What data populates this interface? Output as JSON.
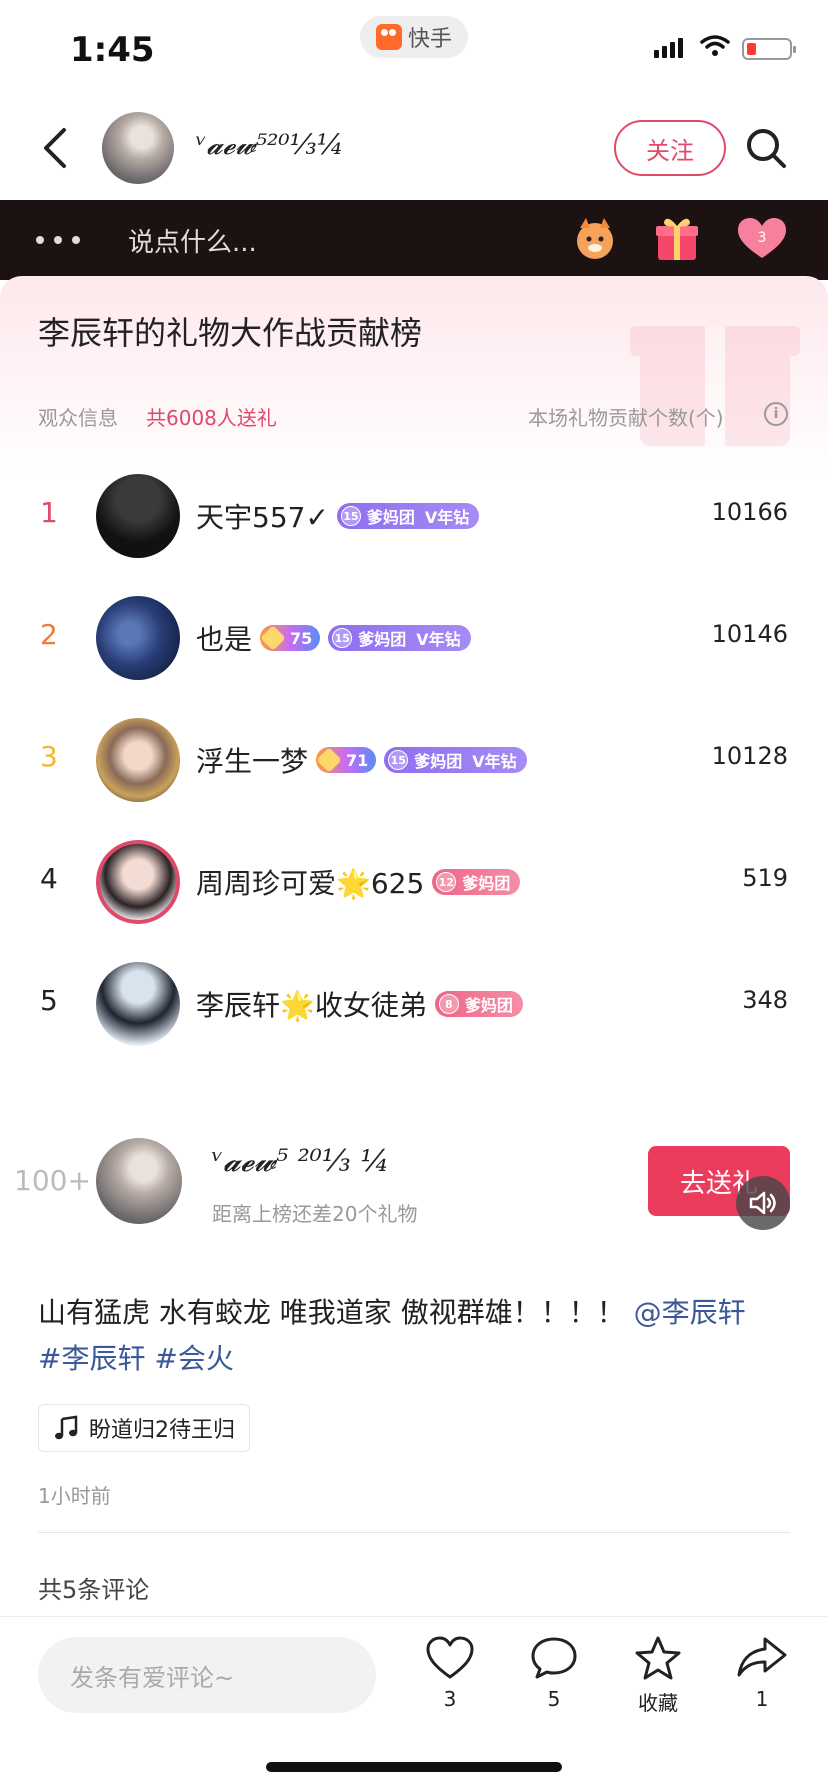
{
  "status_bar": {
    "time": "1:45",
    "app_name": "快手"
  },
  "nav": {
    "username": "ᵛ𝓪𝓮𝔀⁵²⁰¹⁄₃¼",
    "follow_label": "关注"
  },
  "live_bar": {
    "placeholder": "说点什么...",
    "heart_count": "3"
  },
  "panel": {
    "title": "李辰轩的礼物大作战贡献榜",
    "audience_label": "观众信息",
    "audience_count": "共6008人送礼",
    "contribution_label": "本场礼物贡献个数(个)"
  },
  "ranking": [
    {
      "rank": "1",
      "name": "天宇557✓",
      "fans_level": "15",
      "fans_group": "爹妈团",
      "vip": "V年钻",
      "value": "10166",
      "rank_color": "#e04a6a"
    },
    {
      "rank": "2",
      "name": "也是",
      "user_level": "75",
      "fans_level": "15",
      "fans_group": "爹妈团",
      "vip": "V年钻",
      "value": "10146",
      "rank_color": "#f07a3a"
    },
    {
      "rank": "3",
      "name": "浮生一梦",
      "user_level": "71",
      "fans_level": "15",
      "fans_group": "爹妈团",
      "vip": "V年钻",
      "value": "10128",
      "rank_color": "#f2b632"
    },
    {
      "rank": "4",
      "name": "周周珍可爱🌟625",
      "fans_level": "12",
      "fans_group": "爹妈团",
      "value": "519",
      "rank_color": "#222222"
    },
    {
      "rank": "5",
      "name": "李辰轩🌟收女徒弟",
      "fans_level": "8",
      "fans_group": "爹妈团",
      "value": "348",
      "rank_color": "#222222"
    }
  ],
  "my_row": {
    "rank": "100+",
    "username": "ᵛ𝓪𝓮𝔀⁵ ²⁰¹⁄₃ ¼",
    "hint": "距离上榜还差20个礼物",
    "send_label": "去送礼"
  },
  "post": {
    "caption": "山有猛虎 水有蛟龙 唯我道家 傲视群雄！！！！",
    "mention": "@李辰轩",
    "tag1": "#李辰轩",
    "tag2": "#会火",
    "music": "盼道归2待王归",
    "time_ago": "1小时前",
    "comment_count": "共5条评论"
  },
  "bottom_bar": {
    "comment_placeholder": "发条有爱评论~",
    "like_count": "3",
    "comment_count": "5",
    "favorite_label": "收藏",
    "share_count": "1"
  }
}
